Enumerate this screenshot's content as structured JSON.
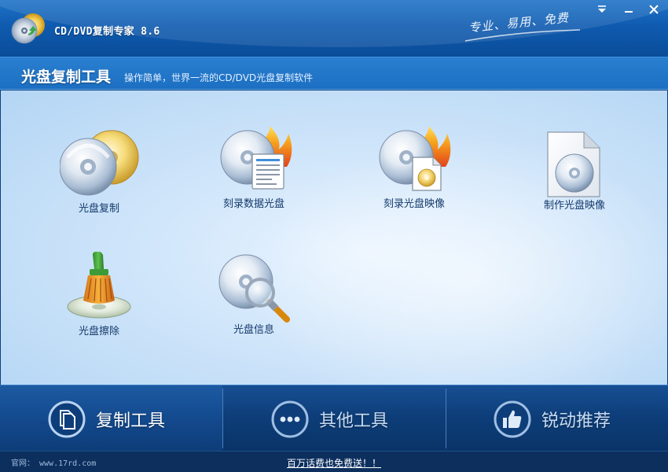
{
  "window": {
    "title": "CD/DVD复制专家 8.6",
    "slogan": "专业、易用、免费",
    "controls": [
      "menu",
      "minimize",
      "close"
    ]
  },
  "section": {
    "title": "光盘复制工具",
    "subtitle": "操作简单，世界一流的CD/DVD光盘复制软件"
  },
  "tools": [
    {
      "label": "光盘复制",
      "icon": "disc-copy-icon"
    },
    {
      "label": "刻录数据光盘",
      "icon": "burn-data-disc-icon"
    },
    {
      "label": "刻录光盘映像",
      "icon": "burn-disc-image-icon"
    },
    {
      "label": "制作光盘映像",
      "icon": "create-disc-image-icon"
    },
    {
      "label": "光盘擦除",
      "icon": "disc-erase-icon"
    },
    {
      "label": "光盘信息",
      "icon": "disc-info-icon"
    }
  ],
  "bottom_nav": [
    {
      "label": "复制工具",
      "icon": "copy-tools-icon",
      "active": true
    },
    {
      "label": "其他工具",
      "icon": "more-tools-icon",
      "active": false
    },
    {
      "label": "锐动推荐",
      "icon": "thumbs-up-icon",
      "active": false
    }
  ],
  "status": {
    "site": "官网： www.17rd.com",
    "promo": "百万话费也免费送！！"
  },
  "colors": {
    "titlebar": "#0f5bb0",
    "content_bg": "#cfe5fa",
    "nav_bg": "#0d3d78",
    "label_text": "#13386a"
  }
}
